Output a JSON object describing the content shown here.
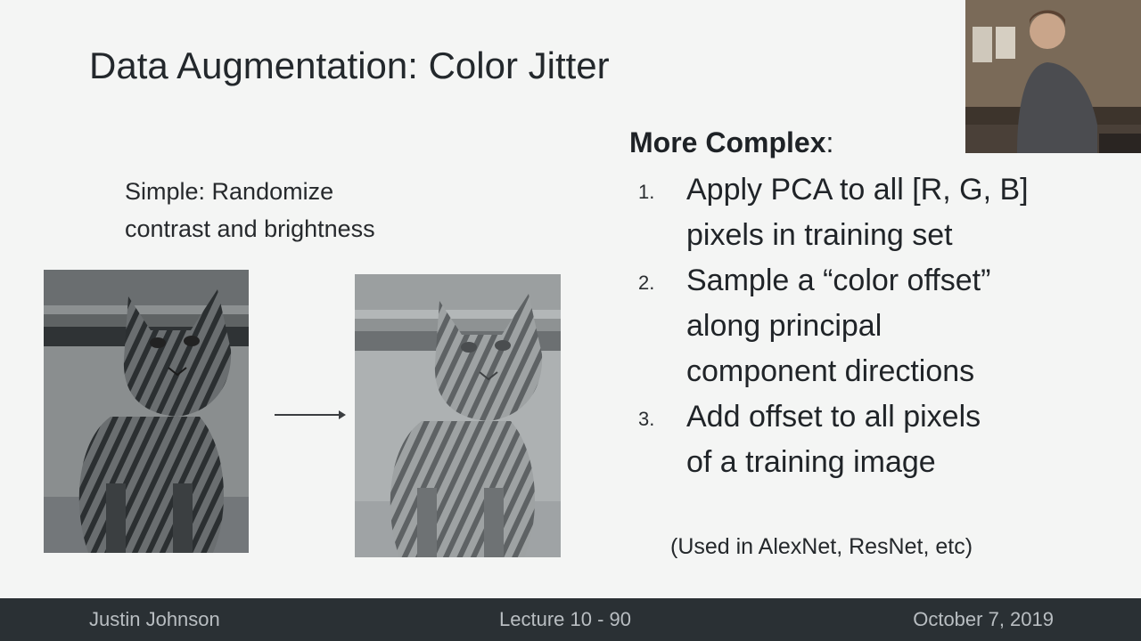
{
  "slide": {
    "title_main": "Data Augmentation",
    "title_rest": ": Color Jitter",
    "simple_line1": "Simple: Randomize",
    "simple_line2": "contrast and brightness",
    "complex_heading": "More Complex",
    "complex_colon": ":",
    "steps": [
      {
        "num": "1.",
        "line1": "Apply PCA to all [R, G, B]",
        "line2": "pixels in training set"
      },
      {
        "num": "2.",
        "line1": "Sample a “color offset”",
        "line2": "along principal",
        "line3": "component directions"
      },
      {
        "num": "3.",
        "line1": "Add offset to all pixels",
        "line2": "of a training image"
      }
    ],
    "note": "(Used in AlexNet, ResNet, etc)"
  },
  "footer": {
    "left": "Justin Johnson",
    "center": "Lecture 10 - 90",
    "right": "October 7, 2019"
  },
  "images": {
    "left": "cat-photo-original",
    "right": "cat-photo-color-jittered",
    "webcam": "presenter-webcam"
  },
  "colors": {
    "footer_bg": "#2a3034",
    "slide_bg": "#f4f5f4",
    "text": "#1f2326"
  }
}
